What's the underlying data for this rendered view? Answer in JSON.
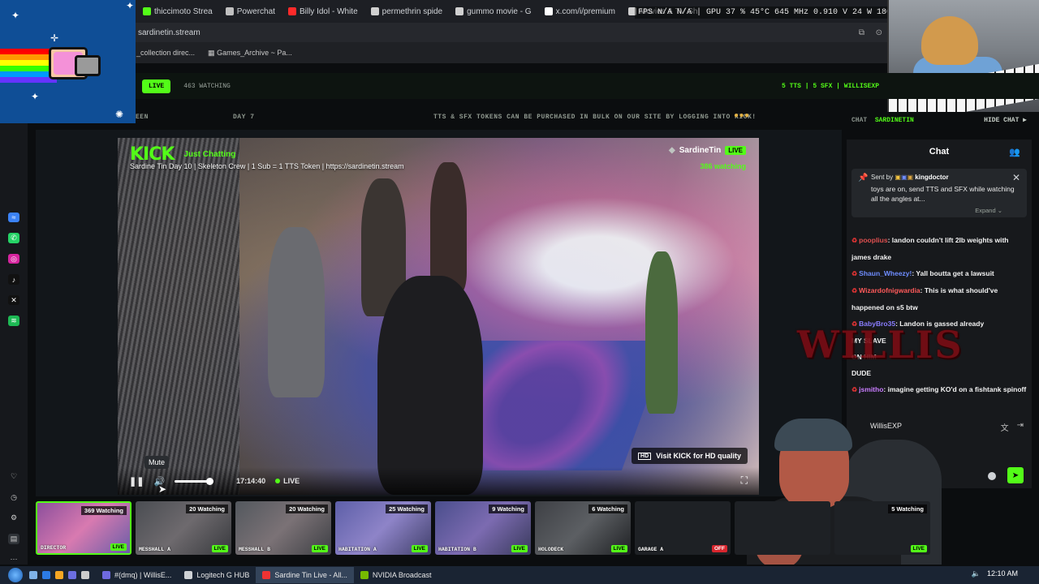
{
  "browser": {
    "tabs": [
      {
        "label": "thiccimoto Strea",
        "color": "#53fc18"
      },
      {
        "label": "Powerchat",
        "color": "#c0c0c0"
      },
      {
        "label": "Billy Idol - White",
        "color": "#ff2a2a"
      },
      {
        "label": "permethrin spide",
        "color": "#d0d0d0"
      },
      {
        "label": "gummo movie - G",
        "color": "#d0d0d0"
      },
      {
        "label": "x.com/i/premium",
        "color": "#ffffff"
      },
      {
        "label": "Movies & TV Sh",
        "color": "#d0d0d0"
      }
    ],
    "osd": "FPS N/A N/A | GPU 37 % 45°C 645 MHz 0.910 V 24 W 1800 RPM",
    "url": "sardinetin.stream",
    "bookmarks": [
      "_collection direc...",
      "Games_Archive ~ Pa..."
    ]
  },
  "site_header": {
    "live_label": "LIVE",
    "watching_text": "463 WATCHING",
    "right_text": "5 TTS | 5 SFX | WILLISEXP"
  },
  "ticker": {
    "left": "EEN",
    "day": "DAY 7",
    "message": "TTS & SFX TOKENS CAN BE PURCHASED IN BULK ON OUR SITE BY LOGGING INTO KICK!"
  },
  "player": {
    "logo": "KICK",
    "category": "Just Chatting",
    "title": "Sardine Tin Day 10 | Skeleton Crew | 1 Sub = 1 TTS Token | https://sardinetin.stream",
    "channel": "SardineTin",
    "live_badge": "LIVE",
    "watching": "386 watching",
    "hd_badge": "HD",
    "hd_text": "Visit KICK for HD quality",
    "time": "17:14:40",
    "live_label": "LIVE",
    "tooltip": "Mute",
    "volume_level": 0.8
  },
  "chat_header": {
    "label": "CHAT",
    "channel": "SARDINETIN",
    "hide": "HIDE CHAT ▶"
  },
  "chat": {
    "title": "Chat",
    "pinned": {
      "sent_by": "Sent by",
      "user": "kingdoctor",
      "message": "toys are on, send TTS and SFX while watching all the angles at...",
      "expand": "Expand ⌄"
    },
    "messages": [
      {
        "user": "pooplius",
        "color": "#e05050",
        "text": "landon couldn't lift 2lb weights with"
      },
      {
        "user": "",
        "color": "#ffffff",
        "text": "james drake"
      },
      {
        "user": "Shaun_Wheezy!",
        "color": "#6f8dff",
        "text": "Yall boutta get a lawsuit"
      },
      {
        "user": "Wizardofnigwardia",
        "color": "#ff5a5a",
        "text": "This is what should've"
      },
      {
        "user": "",
        "color": "#ffffff",
        "text": "happened on s5 btw"
      },
      {
        "user": "BabyBro35",
        "color": "#8a7dff",
        "text": "Landon is gassed already"
      },
      {
        "user": "",
        "color": "#ffffff",
        "text": "MY SLAVE"
      },
      {
        "user": "",
        "color": "#ffffff",
        "text": "ON HIM"
      },
      {
        "user": "",
        "color": "#ffffff",
        "text": "DUDE"
      },
      {
        "user": "jsmitho",
        "color": "#c97dff",
        "text": "imagine getting KO'd on a fishtank spinoff"
      }
    ],
    "input_user": "WillisEXP",
    "overlay_logo": "WILLIS"
  },
  "thumbnails": [
    {
      "name": "DIRECTOR",
      "watching": "369 Watching",
      "status": "LIVE",
      "active": true,
      "bg": "linear-gradient(135deg,#8c4f9c,#d87ab0,#6a5ea8)"
    },
    {
      "name": "MESSHALL A",
      "watching": "20 Watching",
      "status": "LIVE",
      "active": false,
      "bg": "linear-gradient(135deg,#4a4d52,#6e6a6e,#37393d)"
    },
    {
      "name": "MESSHALL B",
      "watching": "20 Watching",
      "status": "LIVE",
      "active": false,
      "bg": "linear-gradient(135deg,#53585e,#7b7276,#3d3f44)"
    },
    {
      "name": "HABITATION A",
      "watching": "25 Watching",
      "status": "LIVE",
      "active": false,
      "bg": "linear-gradient(135deg,#5d5fa8,#8e84c8,#403f6a)"
    },
    {
      "name": "HABITATION B",
      "watching": "9 Watching",
      "status": "LIVE",
      "active": false,
      "bg": "linear-gradient(135deg,#4a4e8c,#7c6bb1,#393a5c)"
    },
    {
      "name": "HOLODECK",
      "watching": "6 Watching",
      "status": "LIVE",
      "active": false,
      "bg": "linear-gradient(135deg,#3e4045,#5c5f63,#1f2124)"
    },
    {
      "name": "GARAGE A",
      "watching": "",
      "status": "OFF",
      "active": false,
      "bg": "#1e2125"
    },
    {
      "name": "",
      "watching": "",
      "status": "",
      "active": false,
      "bg": "#1e2125"
    },
    {
      "name": "",
      "watching": "5 Watching",
      "status": "LIVE",
      "active": false,
      "bg": "#1e2125"
    }
  ],
  "taskbar": {
    "items": [
      {
        "label": "#(dmq) | WillisE...",
        "color": "#6f6ae0",
        "active": false
      },
      {
        "label": "Logitech G HUB",
        "color": "#cfd2d6",
        "active": false
      },
      {
        "label": "Sardine Tin Live - All...",
        "color": "#e33",
        "active": true
      },
      {
        "label": "NVIDIA Broadcast",
        "color": "#76b900",
        "active": false
      }
    ],
    "clock": "12:10 AM"
  }
}
